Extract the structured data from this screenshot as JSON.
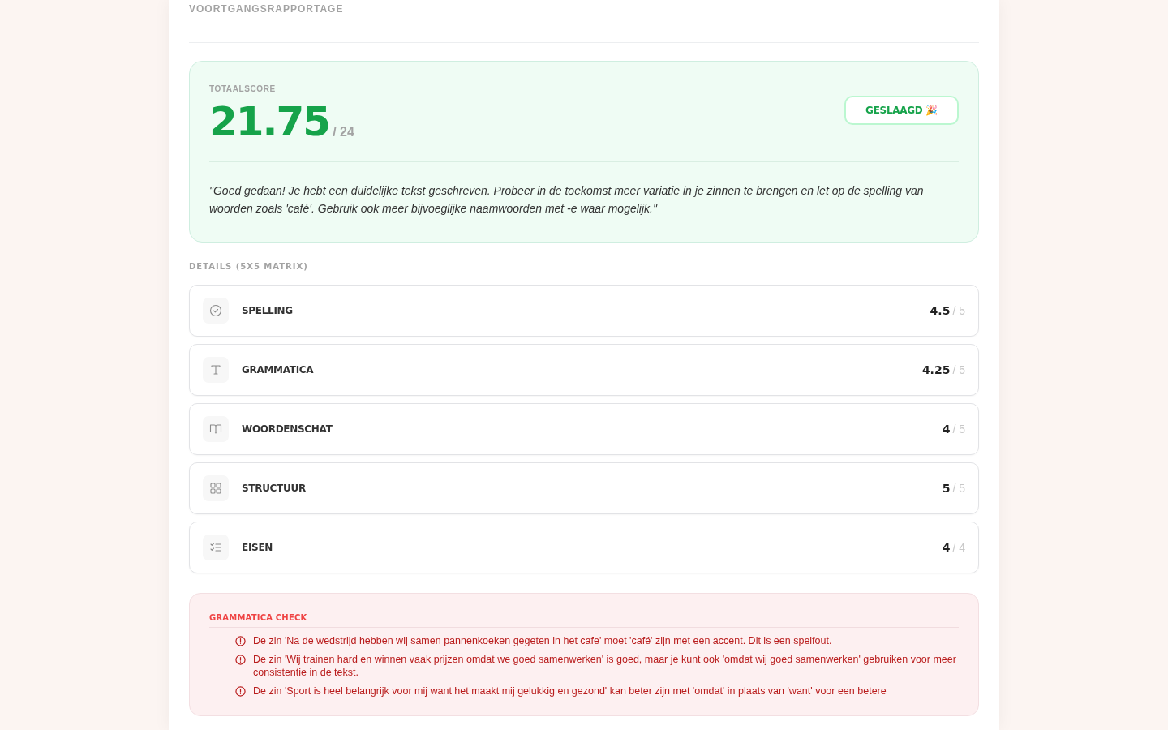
{
  "page_title": "VOORTGANGSRAPPORTAGE",
  "total": {
    "label": "TOTAALSCORE",
    "score": "21.75",
    "max": "/ 24",
    "status": {
      "label": "GESLAAGD 🎉",
      "passed": true
    },
    "feedback": "\"Goed gedaan! Je hebt een duidelijke tekst geschreven. Probeer in de toekomst meer variatie in je zinnen te brengen en let op de spelling van woorden zoals 'café'. Gebruik ook meer bijvoeglijke naamwoorden met -e waar mogelijk.\""
  },
  "details": {
    "title": "DETAILS (5X5 MATRIX)",
    "items": [
      {
        "kind": "check",
        "label": "SPELLING",
        "score": "4.5",
        "max": "/ 5"
      },
      {
        "kind": "text",
        "label": "GRAMMATICA",
        "score": "4.25",
        "max": "/ 5"
      },
      {
        "kind": "book",
        "label": "WOORDENSCHAT",
        "score": "4",
        "max": "/ 5"
      },
      {
        "kind": "grid",
        "label": "STRUCTUUR",
        "score": "5",
        "max": "/ 5"
      },
      {
        "kind": "list",
        "label": "EISEN",
        "score": "4",
        "max": "/ 4"
      }
    ]
  },
  "grammar_check": {
    "title": "GRAMMATICA CHECK",
    "items": [
      "De zin 'Na de wedstrijd hebben wij samen pannenkoeken gegeten in het cafe' moet 'café' zijn met een accent. Dit is een spelfout.",
      "De zin 'Wij trainen hard en winnen vaak prijzen omdat we goed samenwerken' is goed, maar je kunt ook 'omdat wij goed samenwerken' gebruiken voor meer consistentie in de tekst.",
      "De zin 'Sport is heel belangrijk voor mij want het maakt mij gelukkig en gezond' kan beter zijn met 'omdat' in plaats van 'want' voor een betere"
    ]
  }
}
